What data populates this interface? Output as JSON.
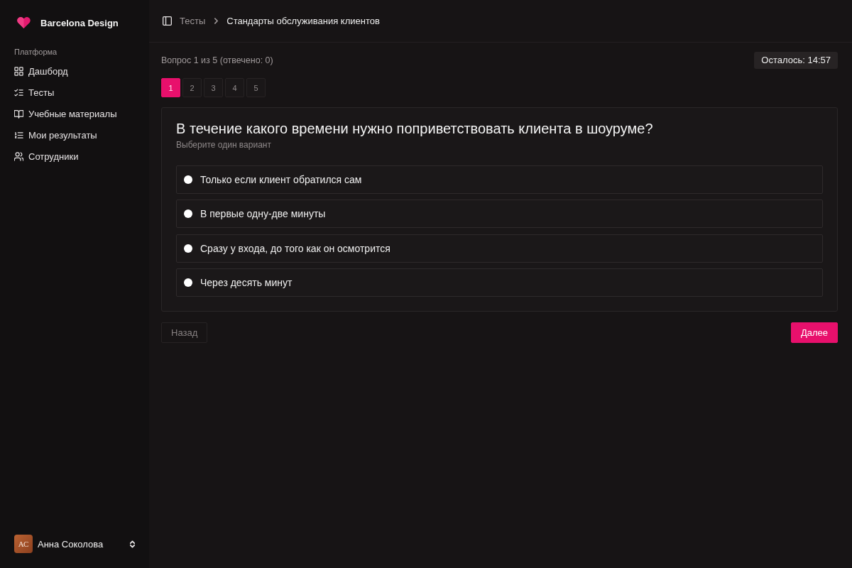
{
  "sidebar": {
    "brand": "Barcelona Design",
    "section_title": "Платформа",
    "items": [
      {
        "label": "Дашборд",
        "selected": false
      },
      {
        "label": "Тесты",
        "selected": false
      },
      {
        "label": "Учебные материалы",
        "selected": false
      },
      {
        "label": "Мои результаты",
        "selected": false
      },
      {
        "label": "Сотрудники",
        "selected": false
      }
    ],
    "user": {
      "initials": "АС",
      "name": "Анна Соколова"
    }
  },
  "header": {
    "breadcrumb": [
      {
        "label": "Тесты"
      },
      {
        "label": "Стандарты обслуживания клиентов"
      }
    ]
  },
  "quiz": {
    "progress": "Вопрос 1 из 5 (отвечено: 0)",
    "timer": "Осталось: 14:57",
    "question_numbers": [
      {
        "label": "1",
        "selected": true
      },
      {
        "label": "2",
        "selected": false
      },
      {
        "label": "3",
        "selected": false
      },
      {
        "label": "4",
        "selected": false
      },
      {
        "label": "5",
        "selected": false
      }
    ],
    "question": "В течение какого времени нужно поприветствовать клиента в шоуруме?",
    "hint": "Выберите один вариант",
    "options": [
      {
        "label": "Только если клиент обратился сам",
        "selected": false
      },
      {
        "label": "В первые одну-две минуты",
        "selected": false
      },
      {
        "label": "Сразу у входа, до того как он осмотрится",
        "selected": false
      },
      {
        "label": "Через десять минут",
        "selected": false
      }
    ],
    "back_button": {
      "label": "Назад",
      "disabled": true
    },
    "next_button": {
      "label": "Далее",
      "disabled": false
    }
  }
}
